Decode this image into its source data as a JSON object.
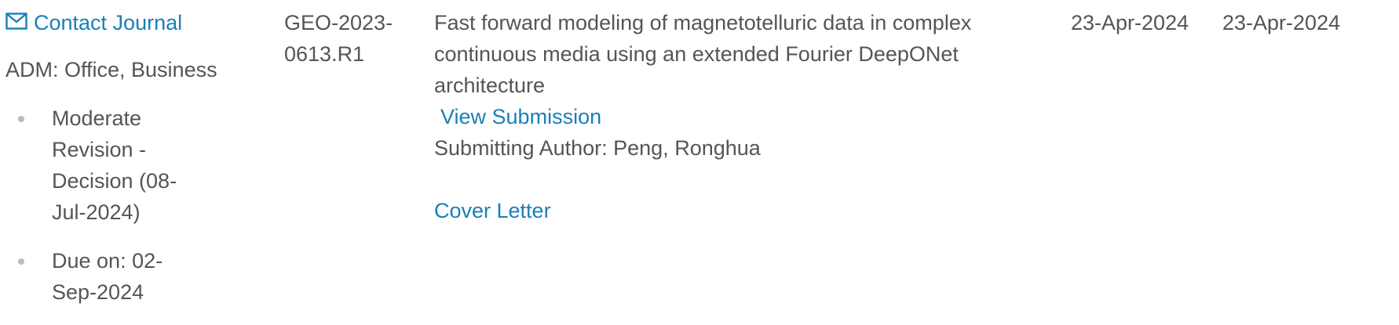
{
  "row": {
    "contact_label": "Contact Journal",
    "adm_label": "ADM: Office, Business",
    "status_items": [
      "Moderate Revision - Decision (08-Jul-2024)",
      "Due on: 02-Sep-2024"
    ],
    "manuscript_id": "GEO-2023-0613.R1",
    "title": "Fast forward modeling of magnetotelluric data in complex continuous media using an extended Fourier DeepONet architecture",
    "view_submission_label": "View Submission",
    "submitting_author": "Submitting Author: Peng, Ronghua",
    "cover_letter_label": "Cover Letter",
    "date_submitted": "23-Apr-2024",
    "date_status": "23-Apr-2024"
  },
  "colors": {
    "link": "#1a7fb8",
    "text": "#555555",
    "bullet": "#bbbbbb"
  },
  "icons": {
    "contact": "envelope-icon"
  }
}
